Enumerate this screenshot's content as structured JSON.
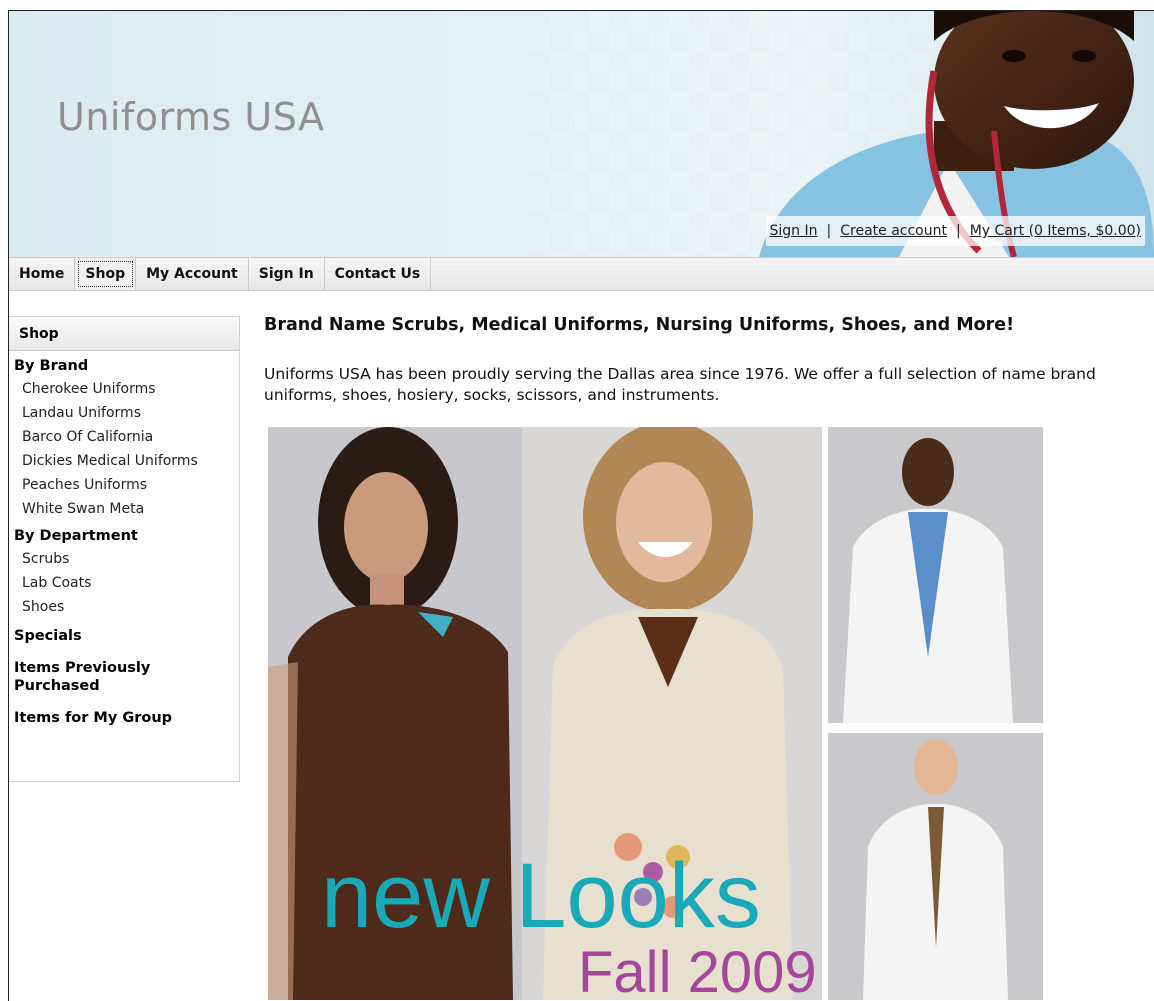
{
  "header": {
    "site_title": "Uniforms USA",
    "links": {
      "sign_in": "Sign In",
      "separator": "|",
      "create_account": "Create account",
      "cart": "My Cart (0 Items, $0.00)"
    }
  },
  "nav": {
    "items": [
      "Home",
      "Shop",
      "My Account",
      "Sign In",
      "Contact Us"
    ],
    "active": "Shop"
  },
  "sidebar": {
    "title": "Shop",
    "by_brand": {
      "heading": "By Brand",
      "items": [
        "Cherokee Uniforms",
        "Landau Uniforms",
        "Barco Of California",
        "Dickies Medical Uniforms",
        "Peaches Uniforms",
        "White Swan Meta"
      ]
    },
    "by_department": {
      "heading": "By Department",
      "items": [
        "Scrubs",
        "Lab Coats",
        "Shoes"
      ]
    },
    "specials": "Specials",
    "previously_purchased": "Items Previously Purchased",
    "my_group": "Items for My Group"
  },
  "main": {
    "title": "Brand Name Scrubs, Medical Uniforms, Nursing Uniforms, Shoes, and More!",
    "intro": "Uniforms USA has been proudly serving the Dallas area since 1976. We offer a full selection of name brand uniforms, shoes, hosiery, socks, scissors, and instruments."
  },
  "promo": {
    "headline": "new Looks",
    "subheadline": "Fall 2009"
  },
  "colors": {
    "teal": "#1aa9b8",
    "purple": "#a2479a",
    "brown_scrub": "#4e2a1a",
    "title_gray": "#8f8f8f"
  }
}
